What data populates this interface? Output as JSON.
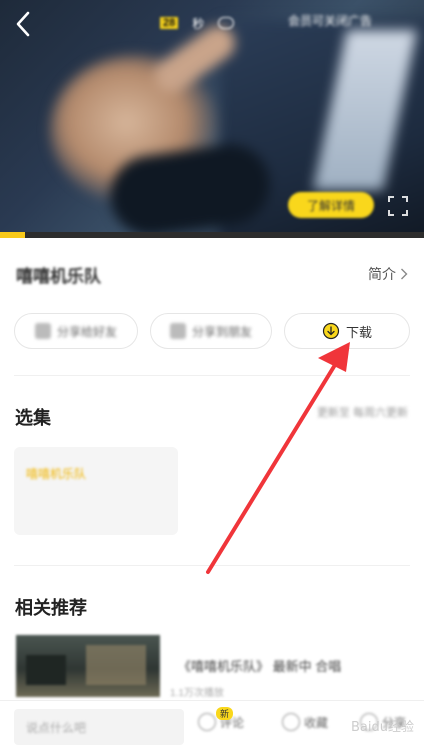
{
  "video": {
    "top_tag": "28",
    "top_text": "秒",
    "ad_text": "会员可关闭广告",
    "caption": "",
    "pill_button": "了解详情",
    "progress_fraction": 0.06
  },
  "header": {
    "title": "嘻嘻机乐队",
    "intro_label": "简介"
  },
  "actions": {
    "btn1": "分享给好友",
    "btn2": "分享到朋友",
    "download_label": "下载"
  },
  "episodes": {
    "title": "选集",
    "update_note": "更新至 每周六更新",
    "card_label": "嘻嘻机乐队"
  },
  "recommend": {
    "title": "相关推荐",
    "item_title": "《嘻嘻机乐队》 最新中 合唱",
    "item_sub": "1.1万次播放"
  },
  "bottom_bar": {
    "comment_placeholder": "说点什么吧",
    "item1": "评论",
    "item1_badge": "新",
    "item2": "收藏",
    "item3": "分享"
  },
  "watermark": "Baidu经验",
  "colors": {
    "accent": "#f9d71c",
    "arrow": "#f0353a"
  }
}
